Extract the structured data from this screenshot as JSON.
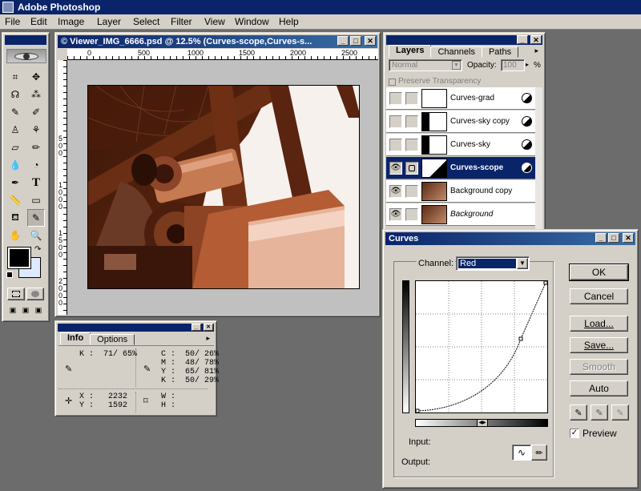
{
  "app": {
    "title": "Adobe Photoshop"
  },
  "menu": [
    "File",
    "Edit",
    "Image",
    "Layer",
    "Select",
    "Filter",
    "View",
    "Window",
    "Help"
  ],
  "document": {
    "title": "© Viewer_IMG_6666.psd @ 12.5% (Curves-scope,Curves-s...",
    "ruler_h": [
      "0",
      "500",
      "1000",
      "1500",
      "2000",
      "2500"
    ],
    "ruler_v": [
      "5 0 0",
      "1 0 0 0",
      "1 5 0 0",
      "2 0 0 0"
    ]
  },
  "layers_panel": {
    "tabs": [
      "Layers",
      "Channels",
      "Paths"
    ],
    "blend_mode": "Normal",
    "opacity_label": "Opacity:",
    "opacity_value": "100",
    "opacity_unit": "%",
    "preserve_label": "Preserve Transparency",
    "layers": [
      {
        "name": "Curves-grad",
        "visible": false,
        "selected": false
      },
      {
        "name": "Curves-sky copy",
        "visible": false,
        "selected": false
      },
      {
        "name": "Curves-sky",
        "visible": false,
        "selected": false
      },
      {
        "name": "Curves-scope",
        "visible": true,
        "selected": true
      },
      {
        "name": "Background copy",
        "visible": true,
        "selected": false
      },
      {
        "name": "Background",
        "visible": true,
        "selected": false
      }
    ]
  },
  "info_panel": {
    "tabs": [
      "Info",
      "Options"
    ],
    "k_line": "K :  71/ 65%",
    "cmyk": [
      "C :  50/ 26%",
      "M :  48/ 78%",
      "Y :  65/ 81%",
      "K :  50/ 29%"
    ],
    "x_line": "X :   2232",
    "y_line": "Y :   1592",
    "w_line": "W :",
    "h_line": "H :"
  },
  "curves": {
    "title": "Curves",
    "channel_label": "Channel:",
    "channel_value": "Red",
    "input_label": "Input:",
    "output_label": "Output:",
    "buttons": {
      "ok": "OK",
      "cancel": "Cancel",
      "load": "Load...",
      "save": "Save...",
      "smooth": "Smooth",
      "auto": "Auto"
    },
    "preview_label": "Preview",
    "preview_checked": true
  },
  "colors": {
    "titlebar": "#0a246a",
    "face": "#d4d0c8",
    "desktop": "#6c6c6c"
  }
}
